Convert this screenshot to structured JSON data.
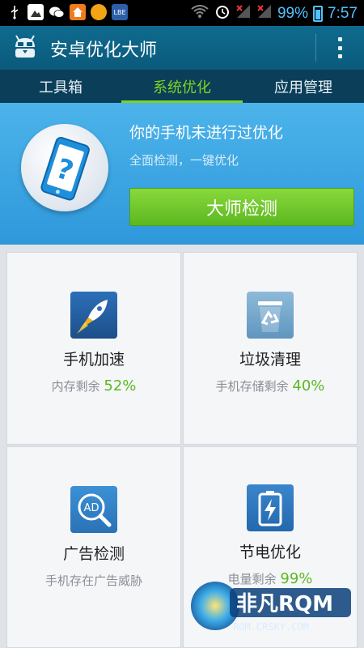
{
  "status_bar": {
    "battery_percent": "99%",
    "time": "7:57",
    "icons": [
      "usb-icon",
      "image-icon",
      "wechat-icon",
      "home-icon",
      "coin-icon",
      "lbe-icon",
      "wifi-icon",
      "alarm-icon",
      "signal-icon",
      "signal-icon-2",
      "battery-icon"
    ]
  },
  "app_bar": {
    "title": "安卓优化大师",
    "menu_icon": "more-vertical-icon",
    "logo_icon": "android-robot-icon"
  },
  "tabs": [
    {
      "label": "工具箱",
      "active": false
    },
    {
      "label": "系统优化",
      "active": true
    },
    {
      "label": "应用管理",
      "active": false
    }
  ],
  "hero": {
    "title": "你的手机未进行过优化",
    "subtitle": "全面检测，一键优化",
    "button_label": "大师检测",
    "icon": "phone-question-icon"
  },
  "cards": [
    {
      "title": "手机加速",
      "sub_text": "内存剩余",
      "value": "52%",
      "icon": "rocket-icon"
    },
    {
      "title": "垃圾清理",
      "sub_text": "手机存储剩余",
      "value": "40%",
      "icon": "recycle-bin-icon"
    },
    {
      "title": "广告检测",
      "sub_text": "手机存在广告威胁",
      "value": "",
      "icon": "ad-search-icon"
    },
    {
      "title": "节电优化",
      "sub_text": "电量剩余",
      "value": "99%",
      "icon": "battery-charge-icon"
    }
  ],
  "watermark": {
    "brand": "非凡RQM",
    "url": "ROM.CRSKY.COM"
  },
  "colors": {
    "accent_green": "#7ed321",
    "hero_blue": "#3aa5e4",
    "appbar": "#0f6b8f",
    "tabs_bg": "#0b3f59"
  }
}
